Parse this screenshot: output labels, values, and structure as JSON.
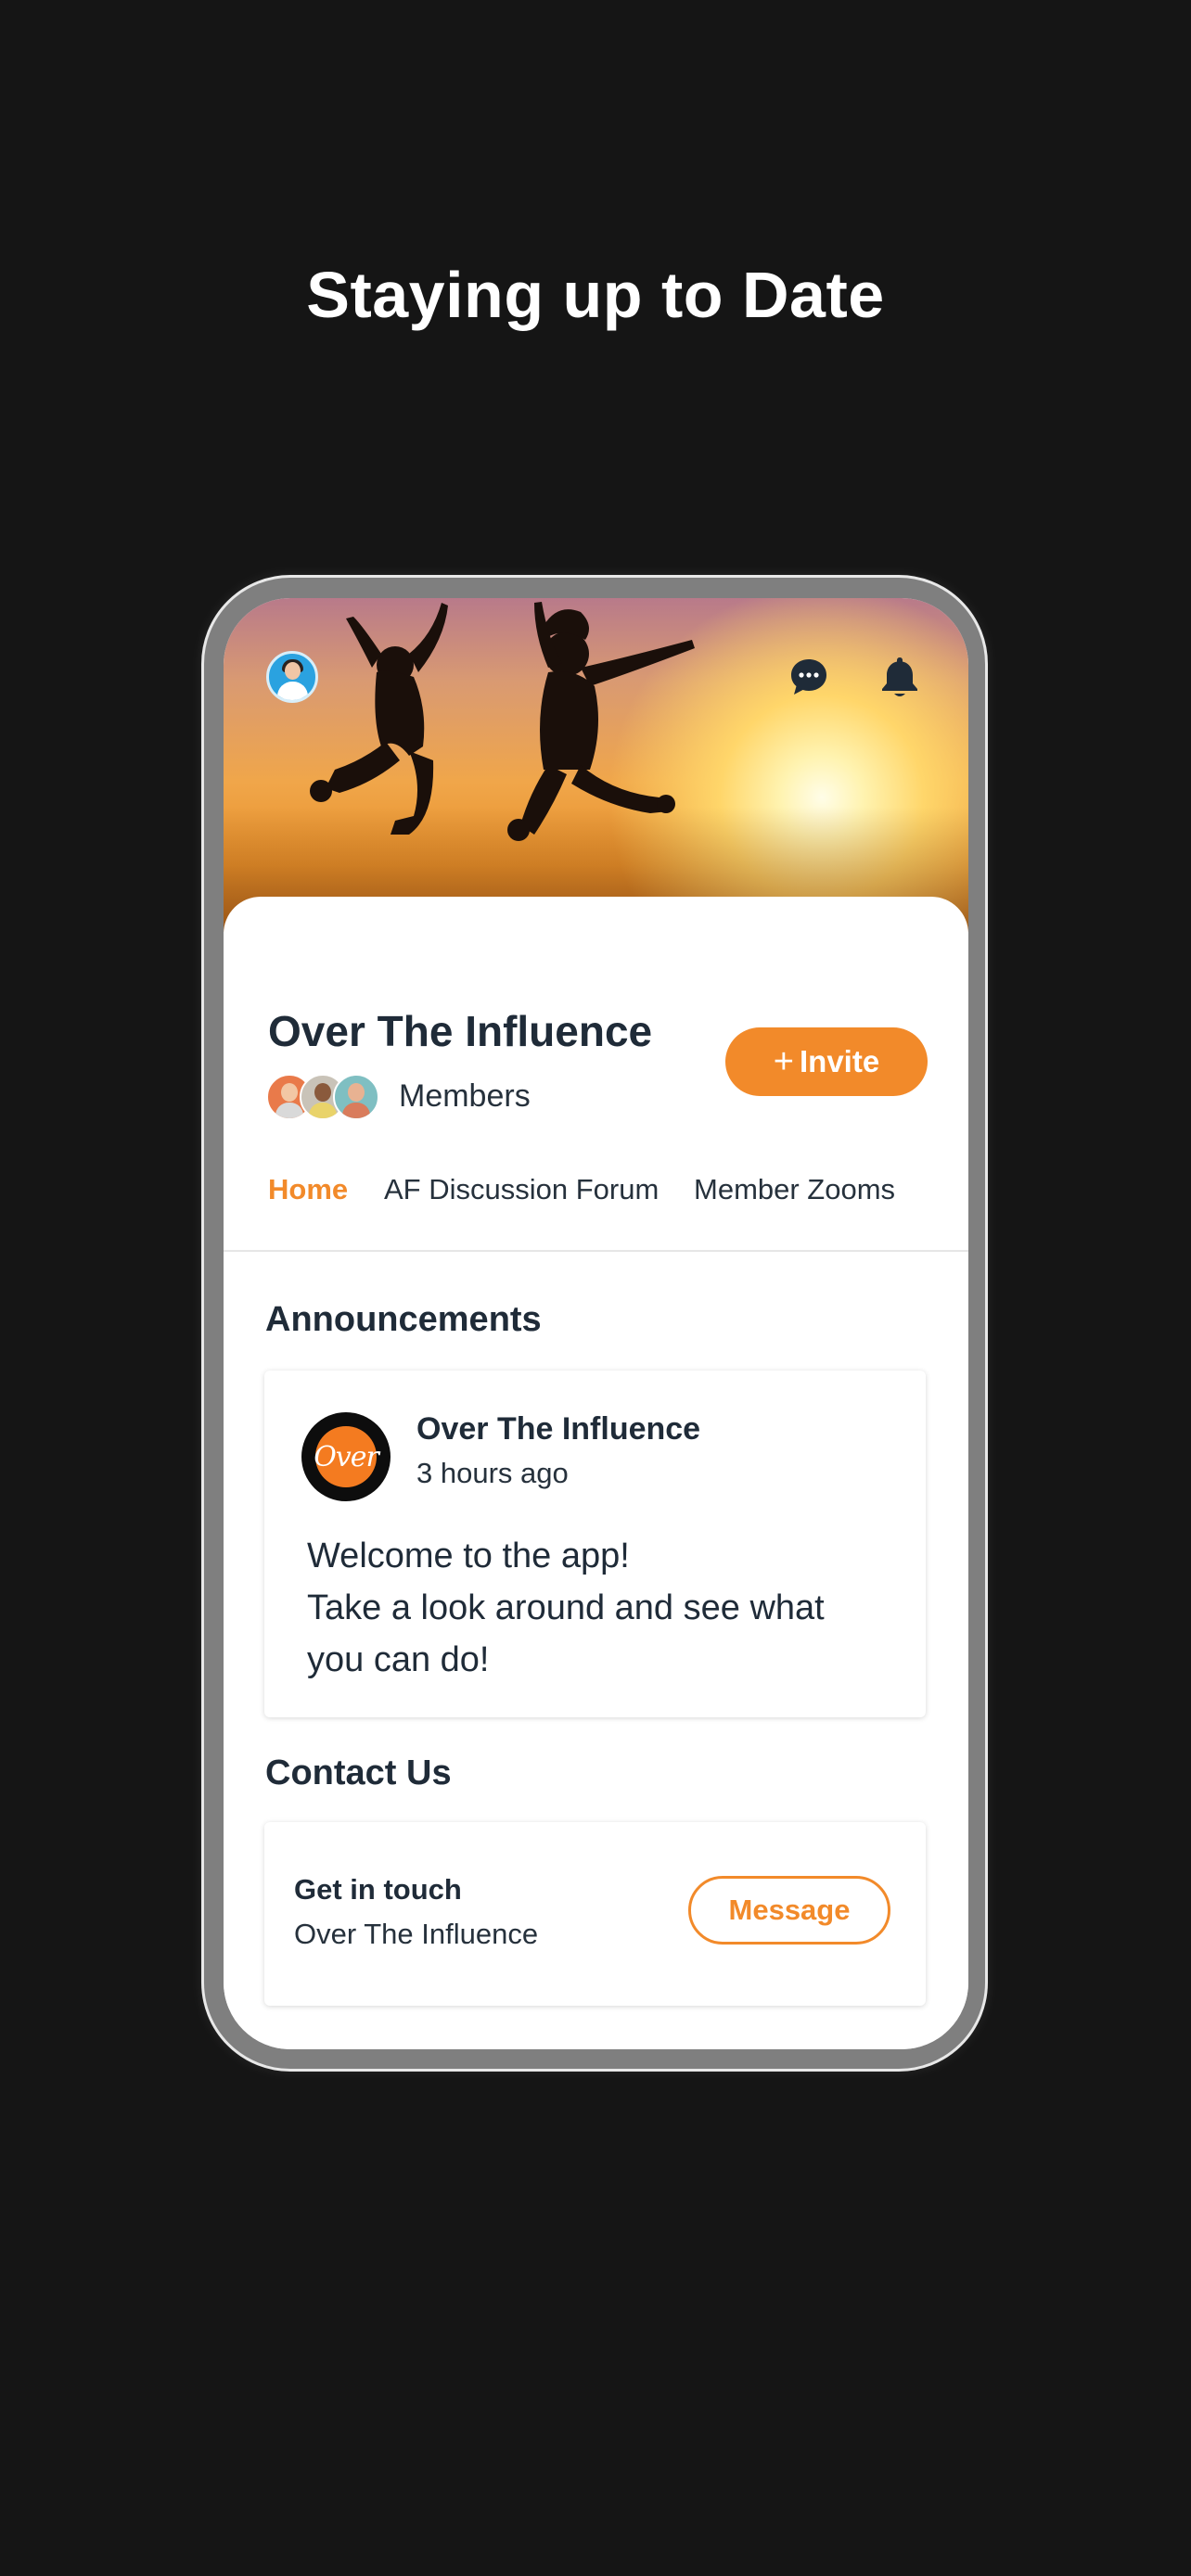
{
  "page": {
    "headline": "Staying up to Date"
  },
  "group": {
    "name": "Over The Influence",
    "members_label": "Members",
    "invite_label": "Invite",
    "invite_icon": "+"
  },
  "tabs": [
    {
      "label": "Home",
      "active": true
    },
    {
      "label": "AF Discussion Forum",
      "active": false
    },
    {
      "label": "Member Zooms",
      "active": false
    }
  ],
  "announcements": {
    "title": "Announcements",
    "post": {
      "author": "Over The Influence",
      "time": "3 hours ago",
      "logo_text": "Over",
      "body_lines": [
        "Welcome to the app!",
        "Take a look around and see what",
        "you can do!"
      ]
    }
  },
  "contact": {
    "title": "Contact Us",
    "heading": "Get in touch",
    "subtitle": "Over The Influence",
    "button_label": "Message"
  },
  "icons": {
    "profile": "avatar",
    "chat": "chat-bubble-icon",
    "notifications": "bell-icon"
  },
  "colors": {
    "accent": "#f28a2a",
    "text_dark": "#1f2b38",
    "background": "#151515",
    "phone_frame": "#7f7f7f"
  }
}
